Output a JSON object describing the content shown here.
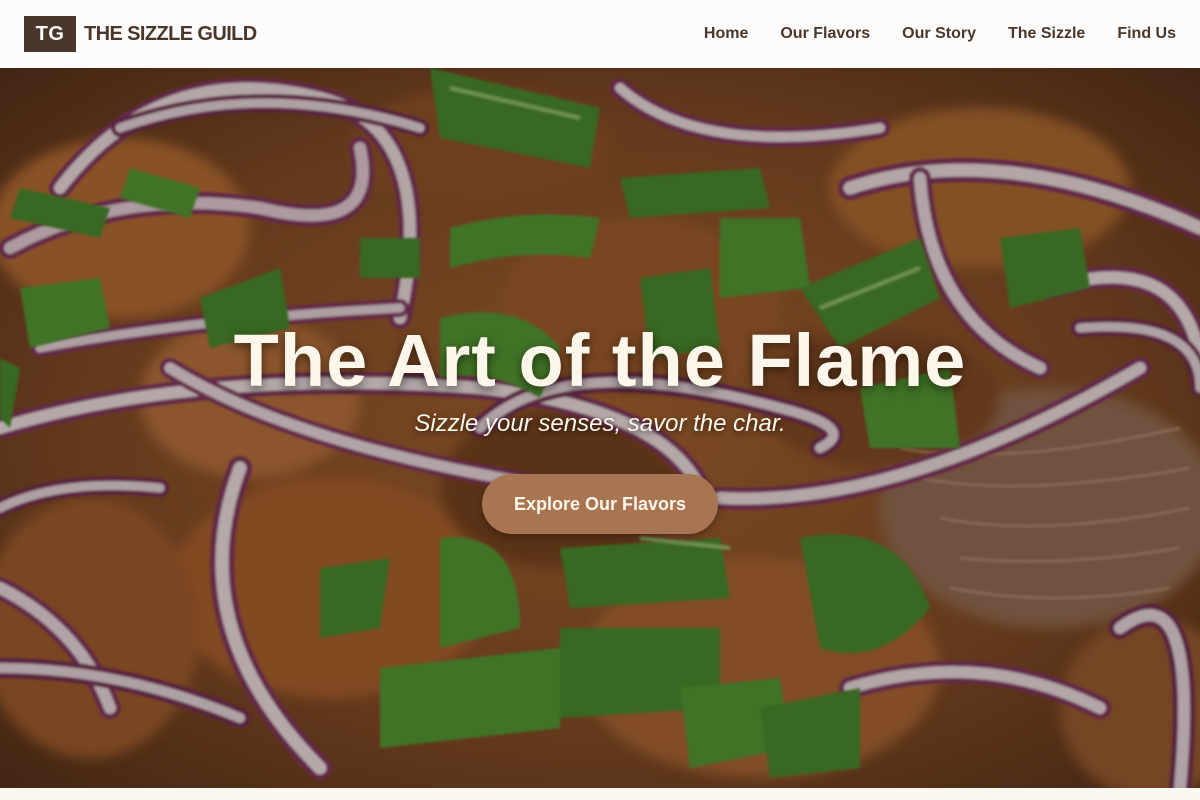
{
  "brand": {
    "logo_initials": "TG",
    "name": "THE SIZZLE GUILD"
  },
  "nav": {
    "links": [
      {
        "label": "Home"
      },
      {
        "label": "Our Flavors"
      },
      {
        "label": "Our Story"
      },
      {
        "label": "The Sizzle"
      },
      {
        "label": "Find Us"
      }
    ]
  },
  "hero": {
    "title": "The Art of the Flame",
    "subtitle": "Sizzle your senses, savor the char.",
    "cta_label": "Explore Our Flavors",
    "image_subject": "close-up of braised pulled meat topped with red onion rings and green onion slices"
  },
  "colors": {
    "brand_brown": "#4a372b",
    "cta_tan": "#a87452",
    "header_bg": "#fdfcfa",
    "hero_text": "#fdf6ea"
  }
}
